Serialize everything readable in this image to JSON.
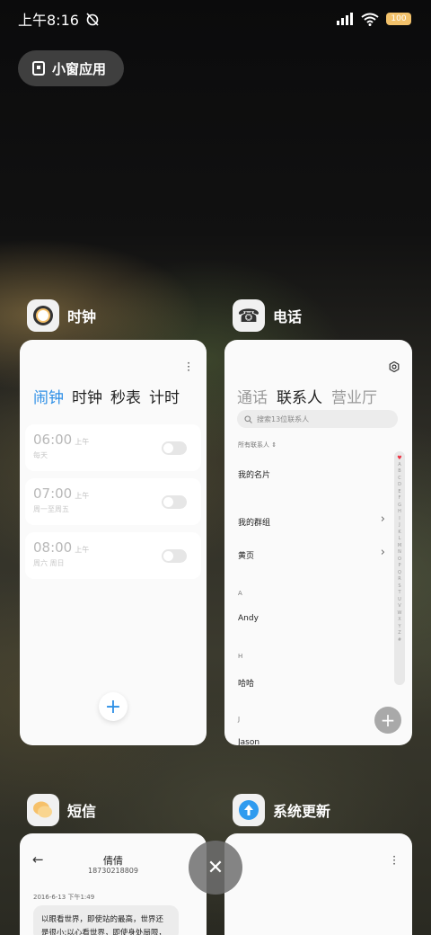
{
  "status_bar": {
    "time": "上午8:16",
    "battery": "100"
  },
  "mini_window": {
    "label": "小窗应用"
  },
  "apps": {
    "clock": {
      "name": "时钟",
      "tabs": [
        "闹钟",
        "时钟",
        "秒表",
        "计时"
      ],
      "alarms": [
        {
          "time": "06:00",
          "ampm": "上午",
          "repeat": "每天"
        },
        {
          "time": "07:00",
          "ampm": "上午",
          "repeat": "周一至周五"
        },
        {
          "time": "08:00",
          "ampm": "上午",
          "repeat": "周六 周日"
        }
      ],
      "add": "+"
    },
    "phone": {
      "name": "电话",
      "tabs": [
        "通话",
        "联系人",
        "营业厅"
      ],
      "search_placeholder": "搜索13位联系人",
      "filter": "所有联系人",
      "my_card": "我的名片",
      "my_groups": "我的群组",
      "yellow_pages": "黄页",
      "section_a": "A",
      "contact_a": "Andy",
      "section_h": "H",
      "contact_h": "哈哈",
      "section_j": "J",
      "contact_j": "Jason",
      "alphabet": [
        "♥",
        "A",
        "B",
        "C",
        "D",
        "E",
        "F",
        "G",
        "H",
        "I",
        "J",
        "K",
        "L",
        "M",
        "N",
        "O",
        "P",
        "Q",
        "R",
        "S",
        "T",
        "U",
        "V",
        "W",
        "X",
        "Y",
        "Z",
        "#"
      ]
    },
    "sms": {
      "name": "短信",
      "contact": "倩倩",
      "number": "18730218809",
      "date": "2016-6-13 下午1:49",
      "message": "以眼看世界，即使站的最高，世界还是很小;以心看世界，即使身处局限，"
    },
    "update": {
      "name": "系统更新"
    }
  },
  "close": "✕"
}
